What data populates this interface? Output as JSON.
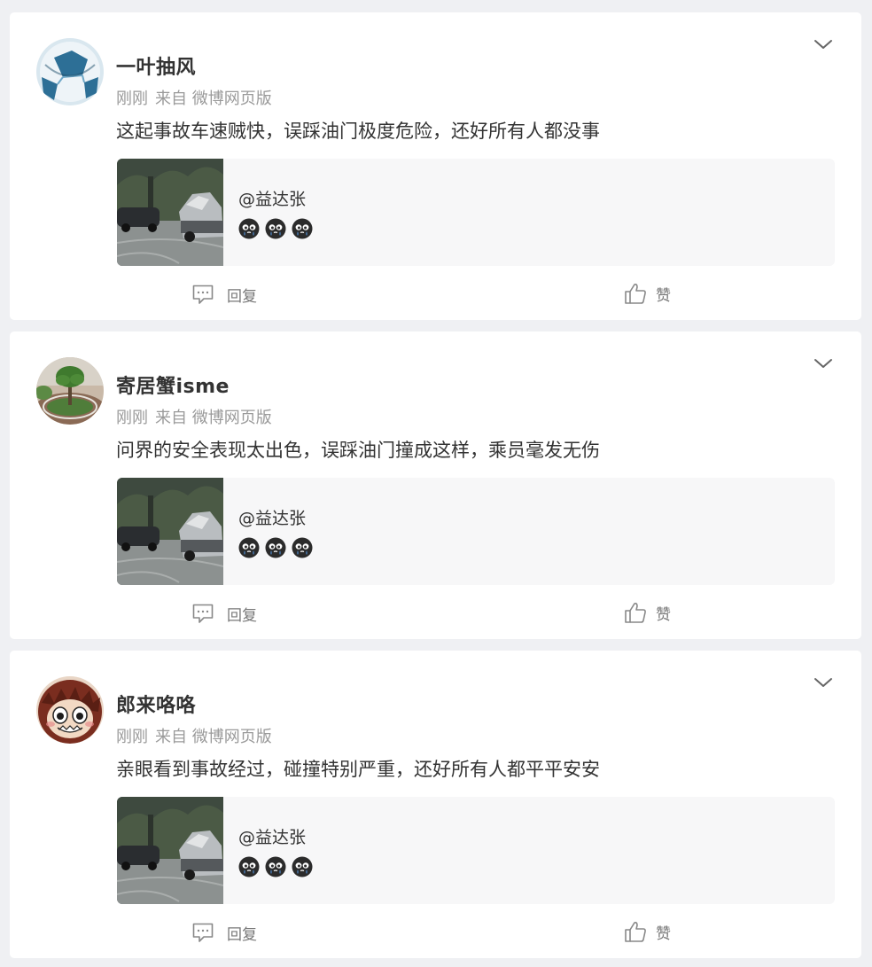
{
  "colors": {
    "page_background": "#eff0f3",
    "card_background": "#ffffff",
    "quote_background": "#f7f7f8",
    "primary_text": "#333333",
    "secondary_text": "#9a9a9a",
    "icon_gray": "#888888"
  },
  "comments": [
    {
      "username": "一叶抽风",
      "time": "刚刚",
      "source": "来自 微博网页版",
      "text": "这起事故车速贼快，误踩油门极度危险，还好所有人都没事",
      "avatar_icon": "soccer-ball-avatar",
      "quote": {
        "author": "@益达张",
        "emoji_icons": [
          "crying-emoji",
          "crying-emoji",
          "crying-emoji"
        ],
        "thumbnail_icon": "car-accident-photo"
      },
      "reply_label": "回复",
      "like_label": "赞"
    },
    {
      "username": "寄居蟹isme",
      "time": "刚刚",
      "source": "来自 微博网页版",
      "text": "问界的安全表现太出色，误踩油门撞成这样，乘员毫发无伤",
      "avatar_icon": "tree-garden-avatar",
      "quote": {
        "author": "@益达张",
        "emoji_icons": [
          "crying-emoji",
          "crying-emoji",
          "crying-emoji"
        ],
        "thumbnail_icon": "car-accident-photo"
      },
      "reply_label": "回复",
      "like_label": "赞"
    },
    {
      "username": "郎来咯咯",
      "time": "刚刚",
      "source": "来自 微博网页版",
      "text": "亲眼看到事故经过，碰撞特别严重，还好所有人都平平安安",
      "avatar_icon": "cartoon-monster-avatar",
      "quote": {
        "author": "@益达张",
        "emoji_icons": [
          "crying-emoji",
          "crying-emoji",
          "crying-emoji"
        ],
        "thumbnail_icon": "car-accident-photo"
      },
      "reply_label": "回复",
      "like_label": "赞"
    }
  ]
}
